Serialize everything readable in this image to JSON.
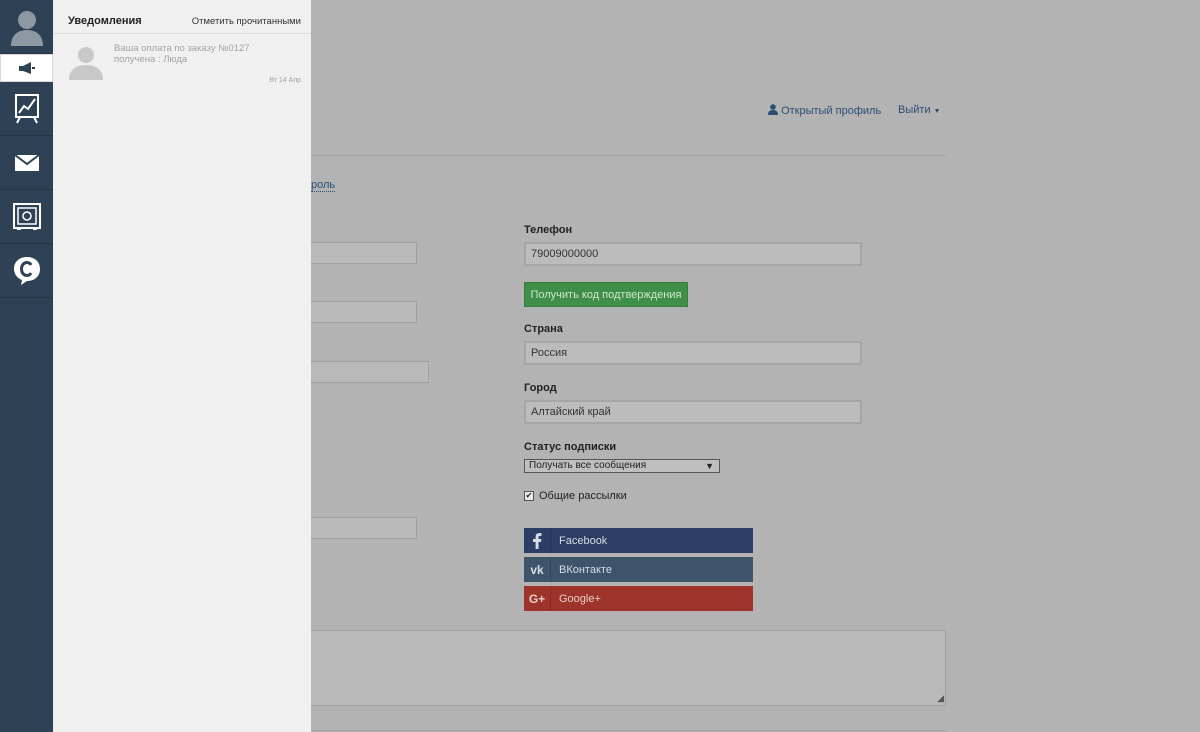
{
  "sidebar": {
    "icons": [
      "user-avatar-icon",
      "megaphone-icon",
      "analytics-chart-icon",
      "mail-icon",
      "safe-icon",
      "chat-icon"
    ]
  },
  "notifications": {
    "title": "Уведомления",
    "mark_read": "Отметить прочитанными",
    "items": [
      {
        "line1": "Ваша оплата по заказу №0127",
        "line2": "получена : Люда",
        "date": "Вт 14 Апр"
      }
    ]
  },
  "header": {
    "open_profile": "Открытый профиль",
    "logout": "Выйти"
  },
  "page": {
    "password_link_fragment": "роль"
  },
  "form": {
    "phone_label": "Телефон",
    "phone_value": "79009000000",
    "get_code_button": "Получить код подтверждения",
    "country_label": "Страна",
    "country_value": "Россия",
    "city_label": "Город",
    "city_value": "Алтайский край",
    "subscription_label": "Статус подписки",
    "subscription_value": "Получать все сообщения",
    "newsletter_label": "Общие рассылки",
    "newsletter_checked": true
  },
  "social": {
    "facebook": "Facebook",
    "vkontakte": "ВКонтакте",
    "google": "Google+"
  },
  "colors": {
    "rail": "#2f4154",
    "panel": "#f0f0f0",
    "overlay_bg": "#b3b3b3",
    "green_button": "#3f8f48",
    "facebook": "#2c3e64",
    "vk": "#3d546b",
    "google": "#9d332a"
  }
}
